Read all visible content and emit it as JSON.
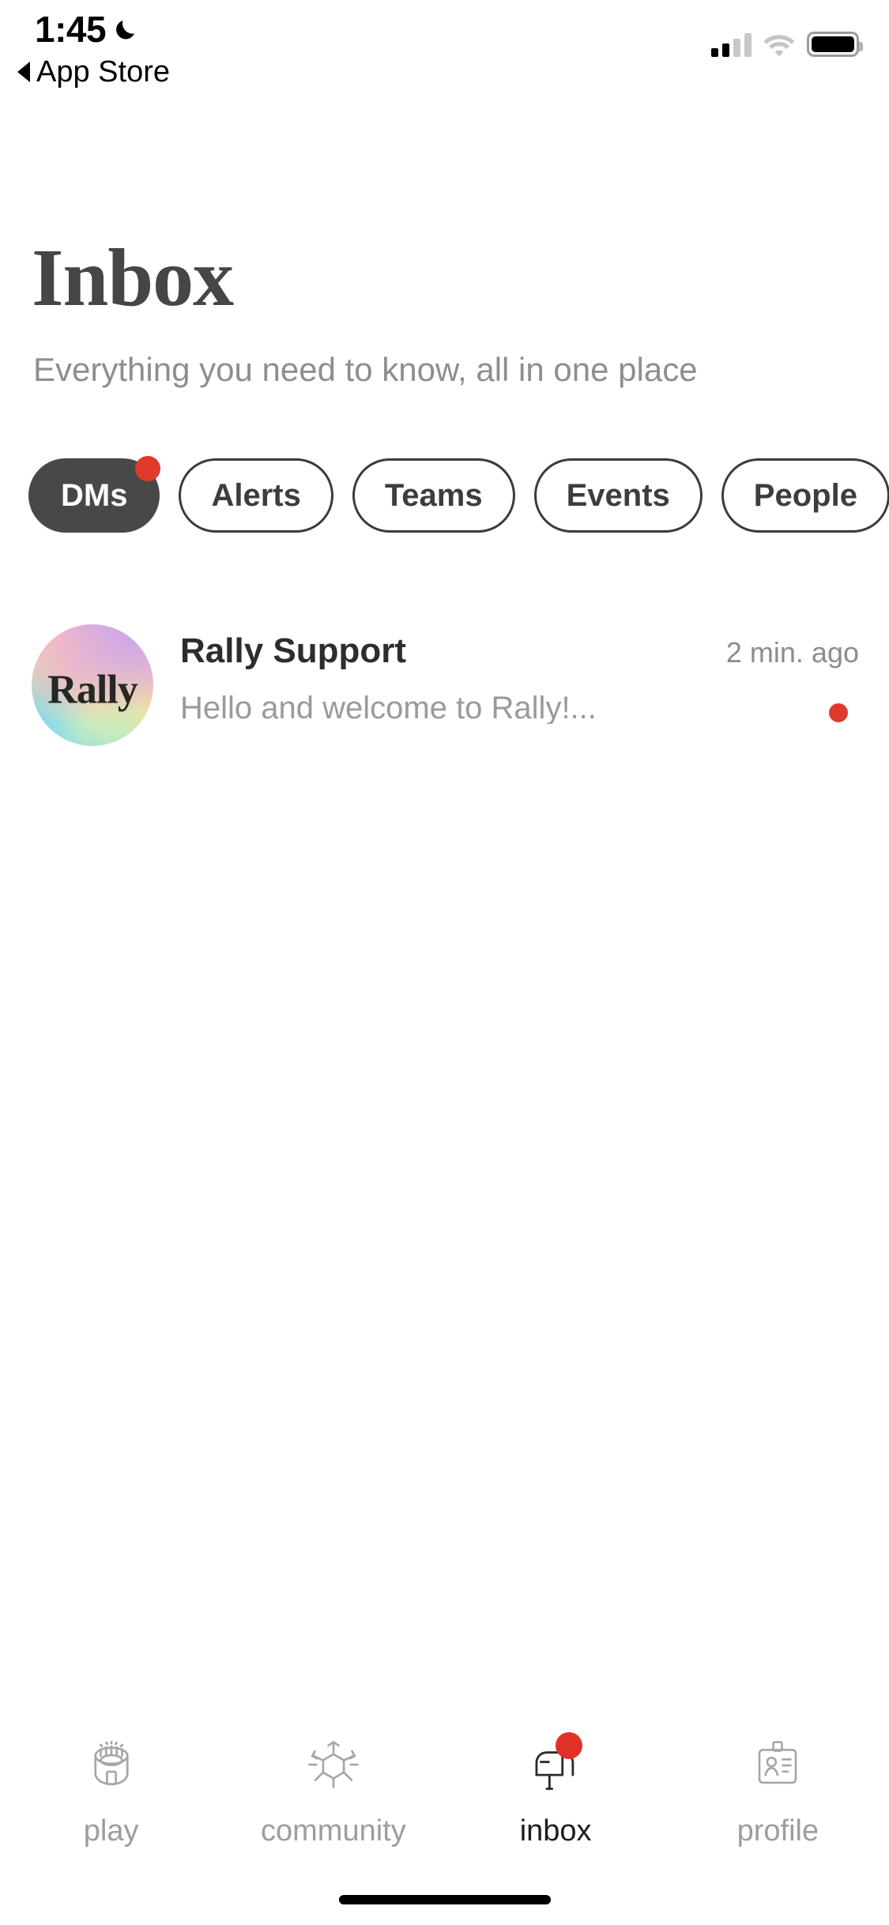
{
  "status_bar": {
    "time": "1:45",
    "moon_icon": "crescent-moon-icon",
    "back_label": "App Store",
    "signal_bars_filled": 2,
    "signal_bars_total": 4,
    "wifi_icon": "wifi-icon",
    "battery_icon": "battery-full-icon"
  },
  "header": {
    "title": "Inbox",
    "subtitle": "Everything you need to know, all in one place"
  },
  "filters": [
    {
      "label": "DMs",
      "active": true,
      "badge": true
    },
    {
      "label": "Alerts",
      "active": false,
      "badge": false
    },
    {
      "label": "Teams",
      "active": false,
      "badge": false
    },
    {
      "label": "Events",
      "active": false,
      "badge": false
    },
    {
      "label": "People",
      "active": false,
      "badge": false
    }
  ],
  "messages": [
    {
      "avatar_text": "Rally",
      "name": "Rally Support",
      "preview": "Hello and welcome to Rally!...",
      "time": "2 min. ago",
      "unread": true
    }
  ],
  "tabs": [
    {
      "label": "play",
      "icon": "stadium-icon",
      "active": false,
      "badge": false
    },
    {
      "label": "community",
      "icon": "molecule-icon",
      "active": false,
      "badge": false
    },
    {
      "label": "inbox",
      "icon": "mailbox-icon",
      "active": true,
      "badge": true
    },
    {
      "label": "profile",
      "icon": "id-card-icon",
      "active": false,
      "badge": false
    }
  ],
  "colors": {
    "accent_red": "#df3a2c",
    "active_pill": "#484848",
    "title_gray": "#464646",
    "muted_gray": "#9a9a9a"
  }
}
